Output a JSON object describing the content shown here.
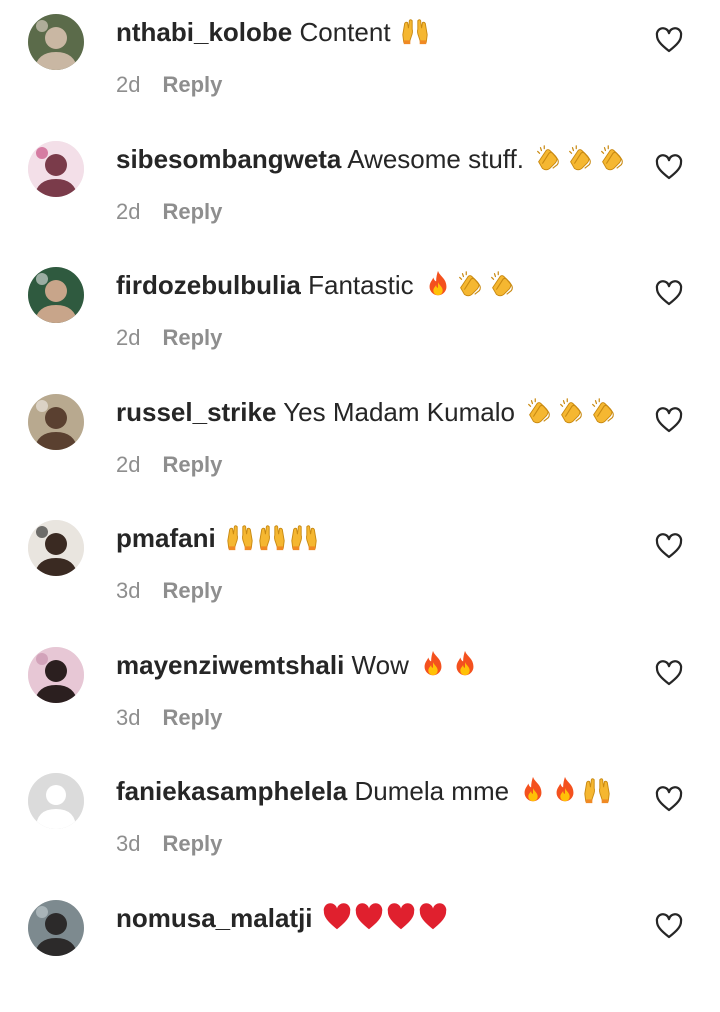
{
  "comments": [
    {
      "username": "nthabi_kolobe",
      "text": "Content",
      "emojis": [
        "raising-hands"
      ],
      "time": "2d",
      "reply_label": "Reply",
      "avatar": {
        "bg": "#5b6b4a",
        "fg": "#c9b7a3",
        "accent": "#e8d9cf"
      }
    },
    {
      "username": "sibesombangweta",
      "text": "Awesome stuff.",
      "emojis": [
        "clapping-hands",
        "clapping-hands",
        "clapping-hands"
      ],
      "time": "2d",
      "reply_label": "Reply",
      "avatar": {
        "bg": "#f3dfe8",
        "fg": "#7a3b4a",
        "accent": "#c23a73"
      }
    },
    {
      "username": "firdozebulbulia",
      "text": "Fantastic",
      "emojis": [
        "fire",
        "clapping-hands",
        "clapping-hands"
      ],
      "time": "2d",
      "reply_label": "Reply",
      "avatar": {
        "bg": "#2f5a3f",
        "fg": "#c8a58a",
        "accent": "#e5e5e5"
      }
    },
    {
      "username": "russel_strike",
      "text": "Yes Madam Kumalo",
      "emojis": [
        "clapping-hands",
        "clapping-hands",
        "clapping-hands"
      ],
      "time": "2d",
      "reply_label": "Reply",
      "avatar": {
        "bg": "#b8a98f",
        "fg": "#5a4030",
        "accent": "#f1efe9"
      }
    },
    {
      "username": "pmafani",
      "text": "",
      "emojis": [
        "raising-hands",
        "raising-hands",
        "raising-hands"
      ],
      "time": "3d",
      "reply_label": "Reply",
      "avatar": {
        "bg": "#e9e5df",
        "fg": "#3a2a22",
        "accent": "#1a1a1a"
      }
    },
    {
      "username": "mayenziwemtshali",
      "text": "Wow",
      "emojis": [
        "fire",
        "fire"
      ],
      "time": "3d",
      "reply_label": "Reply",
      "avatar": {
        "bg": "#e7c7d5",
        "fg": "#2b1f1f",
        "accent": "#c58aa8"
      }
    },
    {
      "username": "faniekasamphelela",
      "text": "Dumela mme",
      "emojis": [
        "fire",
        "fire",
        "raising-hands"
      ],
      "time": "3d",
      "reply_label": "Reply",
      "avatar": {
        "bg": "#dbdbdb",
        "fg": "#ffffff",
        "accent": "#ffffff",
        "default": true
      }
    },
    {
      "username": "nomusa_malatji",
      "text": "",
      "emojis": [
        "red-heart",
        "red-heart",
        "red-heart",
        "red-heart"
      ],
      "time": "",
      "reply_label": "",
      "avatar": {
        "bg": "#7d8a8f",
        "fg": "#2c2a2a",
        "accent": "#c7d0d4"
      }
    }
  ],
  "colors": {
    "username": "#262626",
    "meta": "#8e8e8e",
    "like_outline": "#262626",
    "fire_outer": "#f4511e",
    "fire_inner": "#ffc107",
    "clap": "#f5b731",
    "heart": "#e0202e"
  }
}
